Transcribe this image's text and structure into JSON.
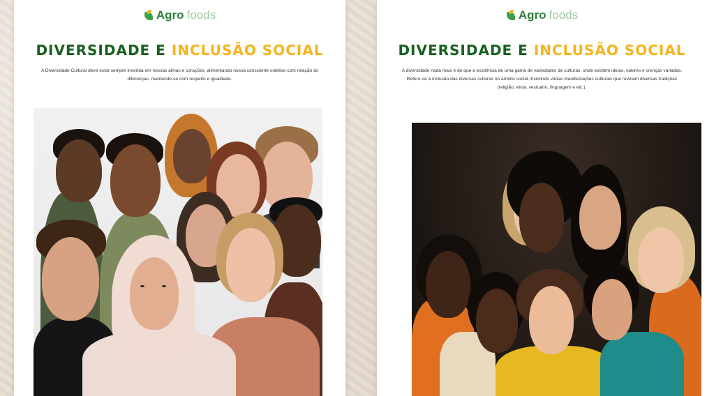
{
  "left_panel": {
    "logo": {
      "agro": "Agro",
      "foods": "foods"
    },
    "title": {
      "part1": "DIVERSIDADE E ",
      "part2": "INCLUSÃO SOCIAL"
    },
    "paragraph": "A Diversidade Cultural deve estar sempre inserida em nossas almas e corações, alimentando nossa consciente coletivo com relação às diferenças, mantendo-se com respeito e igualdade.",
    "photo_label": "group-portrait-diverse-people"
  },
  "right_panel": {
    "logo": {
      "agro": "Agro",
      "foods": "foods"
    },
    "title": {
      "part1": "DIVERSIDADE E ",
      "part2": "INCLUSÃO SOCIAL"
    },
    "paragraph": "A diversidade nada mais é do que a existência de uma gama de variedades de culturas, onde existem ideias, valores e crenças variadas. Refere-se à inclusão das diversas culturas no âmbito social. Existindo várias manifestações culturais que revelam diversas tradições (religião, etnia, vestuário, linguagem e etc.).",
    "photo_label": "group-portrait-smiling-women"
  },
  "colors": {
    "title_green": "#17611f",
    "title_yellow": "#f4b41b",
    "logo_green": "#2e7d3a",
    "logo_light": "#9ec8a4",
    "background": "#e8ded3"
  }
}
